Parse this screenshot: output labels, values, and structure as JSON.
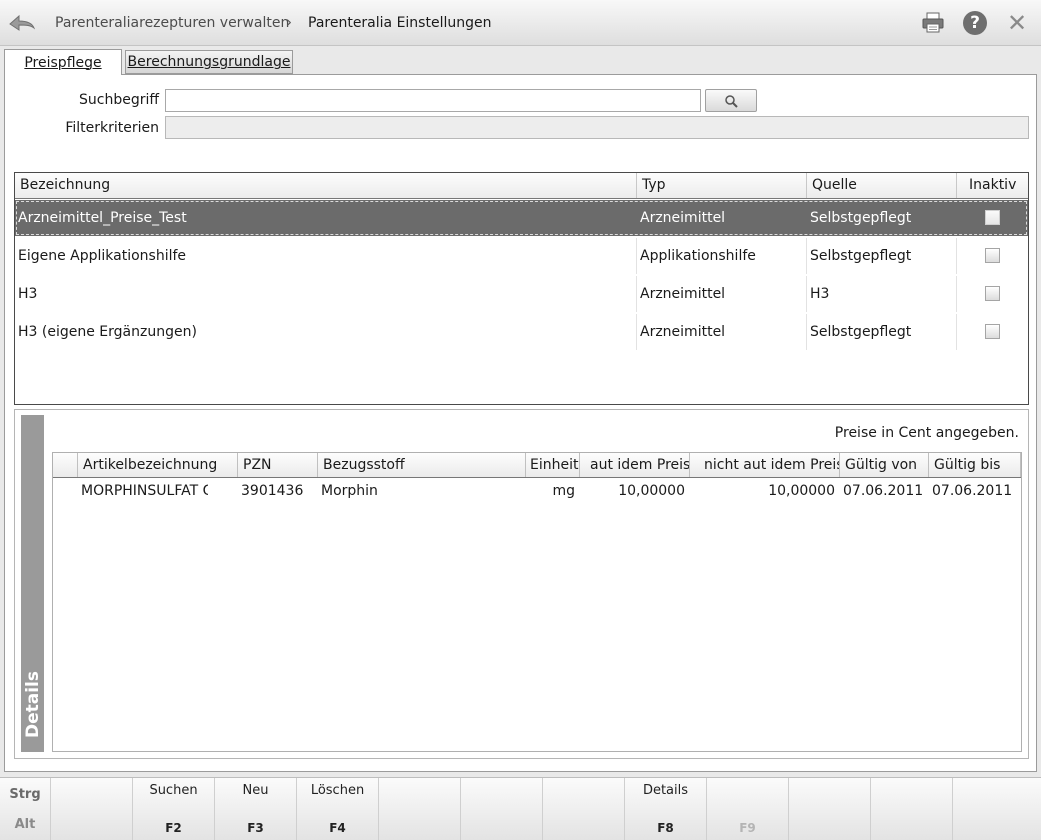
{
  "header": {
    "breadcrumb_parent": "Parenteraliarezepturen verwalten",
    "breadcrumb_separator": "›",
    "breadcrumb_current": "Parenteralia Einstellungen",
    "icons": [
      "back-arrow-icon",
      "printer-icon",
      "help-icon",
      "close-icon"
    ],
    "help_glyph": "?",
    "close_glyph": "✕"
  },
  "tabs": [
    {
      "label": "Preispflege",
      "active": true
    },
    {
      "label": "Berechnungsgrundlage",
      "active": false
    }
  ],
  "search": {
    "label": "Suchbegriff",
    "value": "",
    "filter_label": "Filterkriterien",
    "filter_value": ""
  },
  "main_table": {
    "columns": [
      "Bezeichnung",
      "Typ",
      "Quelle",
      "Inaktiv"
    ],
    "rows": [
      {
        "bezeichnung": "Arzneimittel_Preise_Test",
        "typ": "Arzneimittel",
        "quelle": "Selbstgepflegt",
        "inaktiv": false,
        "selected": true
      },
      {
        "bezeichnung": "Eigene Applikationshilfe",
        "typ": "Applikationshilfe",
        "quelle": "Selbstgepflegt",
        "inaktiv": false,
        "selected": false
      },
      {
        "bezeichnung": "H3",
        "typ": "Arzneimittel",
        "quelle": "H3",
        "inaktiv": false,
        "selected": false
      },
      {
        "bezeichnung": "H3 (eigene Ergänzungen)",
        "typ": "Arzneimittel",
        "quelle": "Selbstgepflegt",
        "inaktiv": false,
        "selected": false
      }
    ]
  },
  "details": {
    "title": "Details",
    "note": "Preise in Cent angegeben.",
    "columns": [
      "",
      "Artikelbezeichnung",
      "PZN",
      "Bezugsstoff",
      "Einheit",
      "aut idem Preis",
      "nicht aut idem Preis",
      "Gültig von",
      "Gültig bis"
    ],
    "rows": [
      {
        "artikel": "MORPHINSULFAT GRY",
        "pzn": "3901436",
        "bezugsstoff": "Morphin",
        "einheit": "mg",
        "aut_idem_preis": "10,00000",
        "nicht_aut_idem_preis": "10,00000",
        "gueltig_von": "07.06.2011",
        "gueltig_bis": "07.06.2011"
      }
    ]
  },
  "function_keys": {
    "modifiers": [
      "Strg",
      "Alt"
    ],
    "keys": [
      {
        "label": "",
        "key": "",
        "enabled": true
      },
      {
        "label": "Suchen",
        "key": "F2",
        "enabled": true
      },
      {
        "label": "Neu",
        "key": "F3",
        "enabled": true
      },
      {
        "label": "Löschen",
        "key": "F4",
        "enabled": true
      },
      {
        "label": "",
        "key": "",
        "enabled": true
      },
      {
        "label": "",
        "key": "",
        "enabled": true
      },
      {
        "label": "",
        "key": "",
        "enabled": true
      },
      {
        "label": "Details",
        "key": "F8",
        "enabled": true
      },
      {
        "label": "",
        "key": "F9",
        "enabled": false
      },
      {
        "label": "",
        "key": "",
        "enabled": true
      },
      {
        "label": "",
        "key": "",
        "enabled": true
      },
      {
        "label": "",
        "key": "",
        "enabled": true
      }
    ]
  }
}
